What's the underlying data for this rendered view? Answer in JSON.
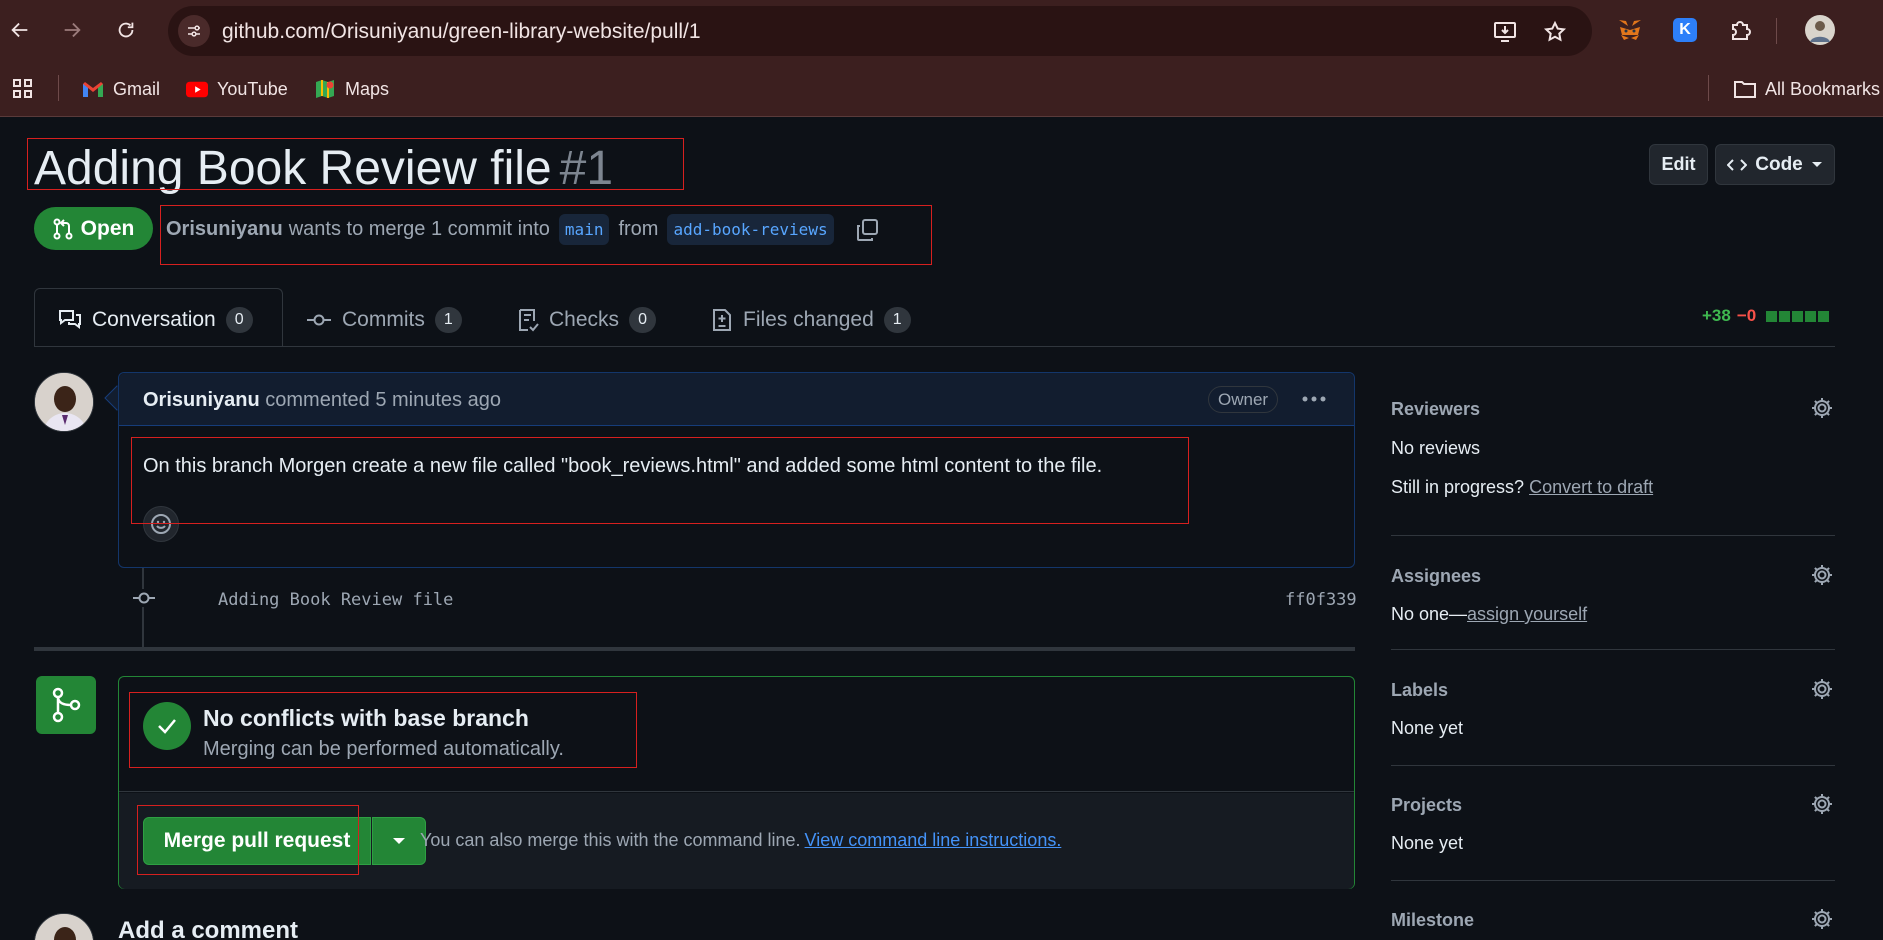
{
  "browser": {
    "url": "github.com/Orisuniyanu/green-library-website/pull/1",
    "bookmarks": [
      {
        "label": "Gmail",
        "icon": "gmail-icon"
      },
      {
        "label": "YouTube",
        "icon": "youtube-icon"
      },
      {
        "label": "Maps",
        "icon": "maps-icon"
      }
    ],
    "all_bookmarks": "All Bookmarks"
  },
  "pr": {
    "title": "Adding Book Review file",
    "number": "#1",
    "edit_label": "Edit",
    "code_label": "Code",
    "state": "Open",
    "author": "Orisuniyanu",
    "merge_text": "wants to merge 1 commit into",
    "base_branch": "main",
    "from_text": "from",
    "head_branch": "add-book-reviews"
  },
  "tabs": [
    {
      "label": "Conversation",
      "count": "0",
      "icon": "conversation-icon"
    },
    {
      "label": "Commits",
      "count": "1",
      "icon": "commit-icon"
    },
    {
      "label": "Checks",
      "count": "0",
      "icon": "checks-icon"
    },
    {
      "label": "Files changed",
      "count": "1",
      "icon": "file-diff-icon"
    }
  ],
  "diffstat": {
    "additions": "+38",
    "deletions": "−0"
  },
  "comment": {
    "author": "Orisuniyanu",
    "meta": "commented 5 minutes ago",
    "badge": "Owner",
    "body": "On this branch Morgen create a new file called \"book_reviews.html\" and added some html content to the file."
  },
  "commit": {
    "message": "Adding Book Review file",
    "sha": "ff0f339"
  },
  "merge": {
    "title": "No conflicts with base branch",
    "subtitle": "Merging can be performed automatically.",
    "button": "Merge pull request",
    "hint": "You can also merge this with the command line.",
    "hint_link": "View command line instructions."
  },
  "add_comment": "Add a comment",
  "sidebar": {
    "reviewers": {
      "title": "Reviewers",
      "value": "No reviews",
      "progress_q": "Still in progress?",
      "progress_link": "Convert to draft"
    },
    "assignees": {
      "title": "Assignees",
      "value": "No one—",
      "link": "assign yourself"
    },
    "labels": {
      "title": "Labels",
      "value": "None yet"
    },
    "projects": {
      "title": "Projects",
      "value": "None yet"
    },
    "milestone": {
      "title": "Milestone"
    }
  },
  "colors": {
    "accent_green": "#238636",
    "link_blue": "#4493f8",
    "chrome": "#3c1f1f",
    "highlight_box": "#d6201f"
  }
}
